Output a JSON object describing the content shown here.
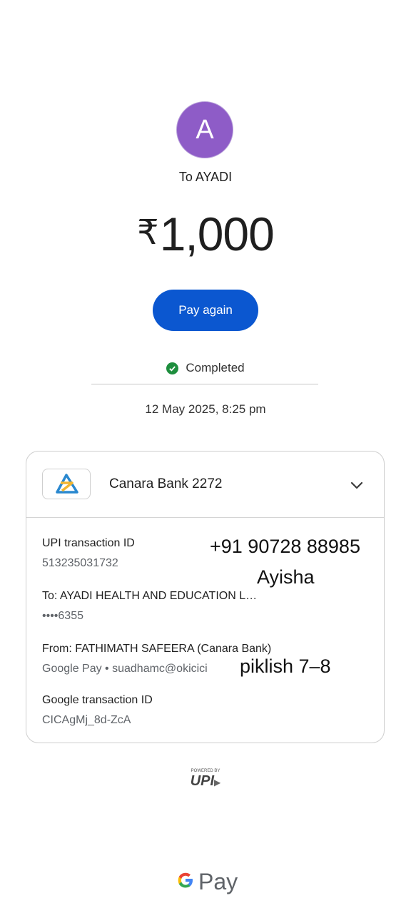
{
  "recipient": {
    "avatar_letter": "A",
    "avatar_color": "#8e5cc7",
    "label": "To AYADI"
  },
  "payment": {
    "currency_symbol": "₹",
    "amount": "1,000",
    "pay_again_label": "Pay again",
    "status": "Completed",
    "status_color": "#1e8e3e",
    "datetime": "12 May 2025, 8:25 pm"
  },
  "card": {
    "bank_name": "Canara Bank 2272",
    "upi_id_label": "UPI transaction ID",
    "upi_id_value": "513235031732",
    "to_label": "To: AYADI HEALTH AND EDUCATION L…",
    "to_account": "••••6355",
    "from_label": "From: FATHIMATH  SAFEERA (Canara Bank)",
    "from_detail": "Google Pay • suadhamc@okicici",
    "google_id_label": "Google transaction ID",
    "google_id_value": "CICAgMj_8d-ZcA"
  },
  "annotations": {
    "phone": "+91 90728 88985",
    "name": "Ayisha",
    "note": "piklish 7–8"
  },
  "footer": {
    "upi_powered_by": "POWERED BY",
    "upi_text": "UPI",
    "gpay_text": "Pay"
  },
  "accent_color": "#0b57d0"
}
